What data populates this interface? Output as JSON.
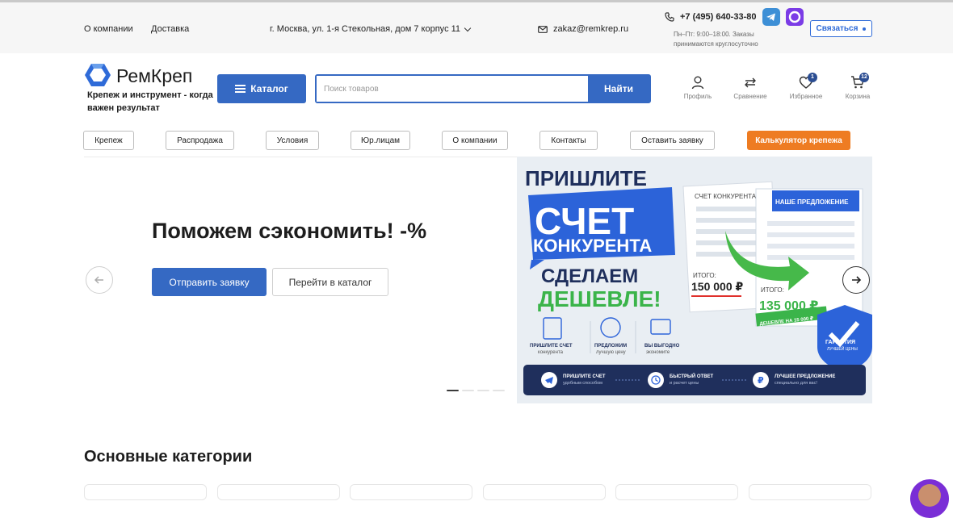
{
  "topbar": {
    "links": [
      "О компании",
      "Доставка"
    ],
    "address": "г. Москва, ул. 1-я Стекольная, дом 7 корпус 11",
    "email": "zakaz@remkrep.ru",
    "phone": "+7 (495) 640-33-80",
    "hours": "Пн–Пт: 9:00–18:00. Заказы принимаются круглосуточно",
    "contact_label": "Связаться",
    "colors": {
      "telegram": "#3d8fd6",
      "max": "#7b3ce6",
      "accent": "#2f6bd8"
    }
  },
  "header": {
    "logo_name": "РемКреп",
    "logo_tagline": "Крепеж и инструмент - когда важен результат",
    "catalog_label": "Каталог",
    "search_placeholder": "Поиск товаров",
    "search_button": "Найти",
    "icons": [
      {
        "name": "Профиль",
        "icon": "user-icon"
      },
      {
        "name": "Сравнение",
        "icon": "compare-icon"
      },
      {
        "name": "Избранное",
        "icon": "heart-icon",
        "badge": "1"
      },
      {
        "name": "Корзина",
        "icon": "cart-icon",
        "badge": "12"
      }
    ]
  },
  "nav": [
    "Крепеж",
    "Распродажа",
    "Условия",
    "Юр.лицам",
    "О компании",
    "Контакты",
    "Оставить заявку",
    "Калькулятор крепежа"
  ],
  "hero": {
    "title": "Поможем сэкономить! -%",
    "primary_button": "Отправить заявку",
    "secondary_button": "Перейти в каталог",
    "slide_count": 4,
    "active_slide": 1
  },
  "banner": {
    "line1": "ПРИШЛИТЕ",
    "line2": "СЧЕТ",
    "line3": "КОНКУРЕНТА",
    "line4": "СДЕЛАЕМ",
    "line5": "ДЕШЕВЛЕ!",
    "competitor_label": "СЧЕТ КОНКУРЕНТА",
    "our_label": "НАШЕ ПРЕДЛОЖЕНИЕ",
    "total_label": "ИТОГО:",
    "competitor_total": "150 000 ₽",
    "our_total": "135 000 ₽",
    "discount": "ДЕШЕВЛЕ НА 15 000 ₽",
    "shield_1": "ГАРАНТИЯ",
    "shield_2": "ЛУЧШЕЙ ЦЕНЫ",
    "features": [
      {
        "title": "ПРИШЛИТЕ СЧЕТ",
        "sub": "конкурента",
        "icon": "document-icon"
      },
      {
        "title": "ПРЕДЛОЖИМ",
        "sub": "лучшую цену",
        "icon": "percent-icon"
      },
      {
        "title": "ВЫ ВЫГОДНО",
        "sub": "экономите",
        "icon": "wallet-icon"
      }
    ],
    "steps": [
      {
        "title": "ПРИШЛИТЕ СЧЕТ",
        "sub": "удобным способом",
        "icon": "telegram-icon"
      },
      {
        "title": "БЫСТРЫЙ ОТВЕТ",
        "sub": "и расчет цены",
        "icon": "clock-icon"
      },
      {
        "title": "ЛУЧШЕЕ ПРЕДЛОЖЕНИЕ",
        "sub": "специально для вас!",
        "icon": "ruble-icon"
      }
    ]
  },
  "categories": {
    "title": "Основные категории"
  }
}
